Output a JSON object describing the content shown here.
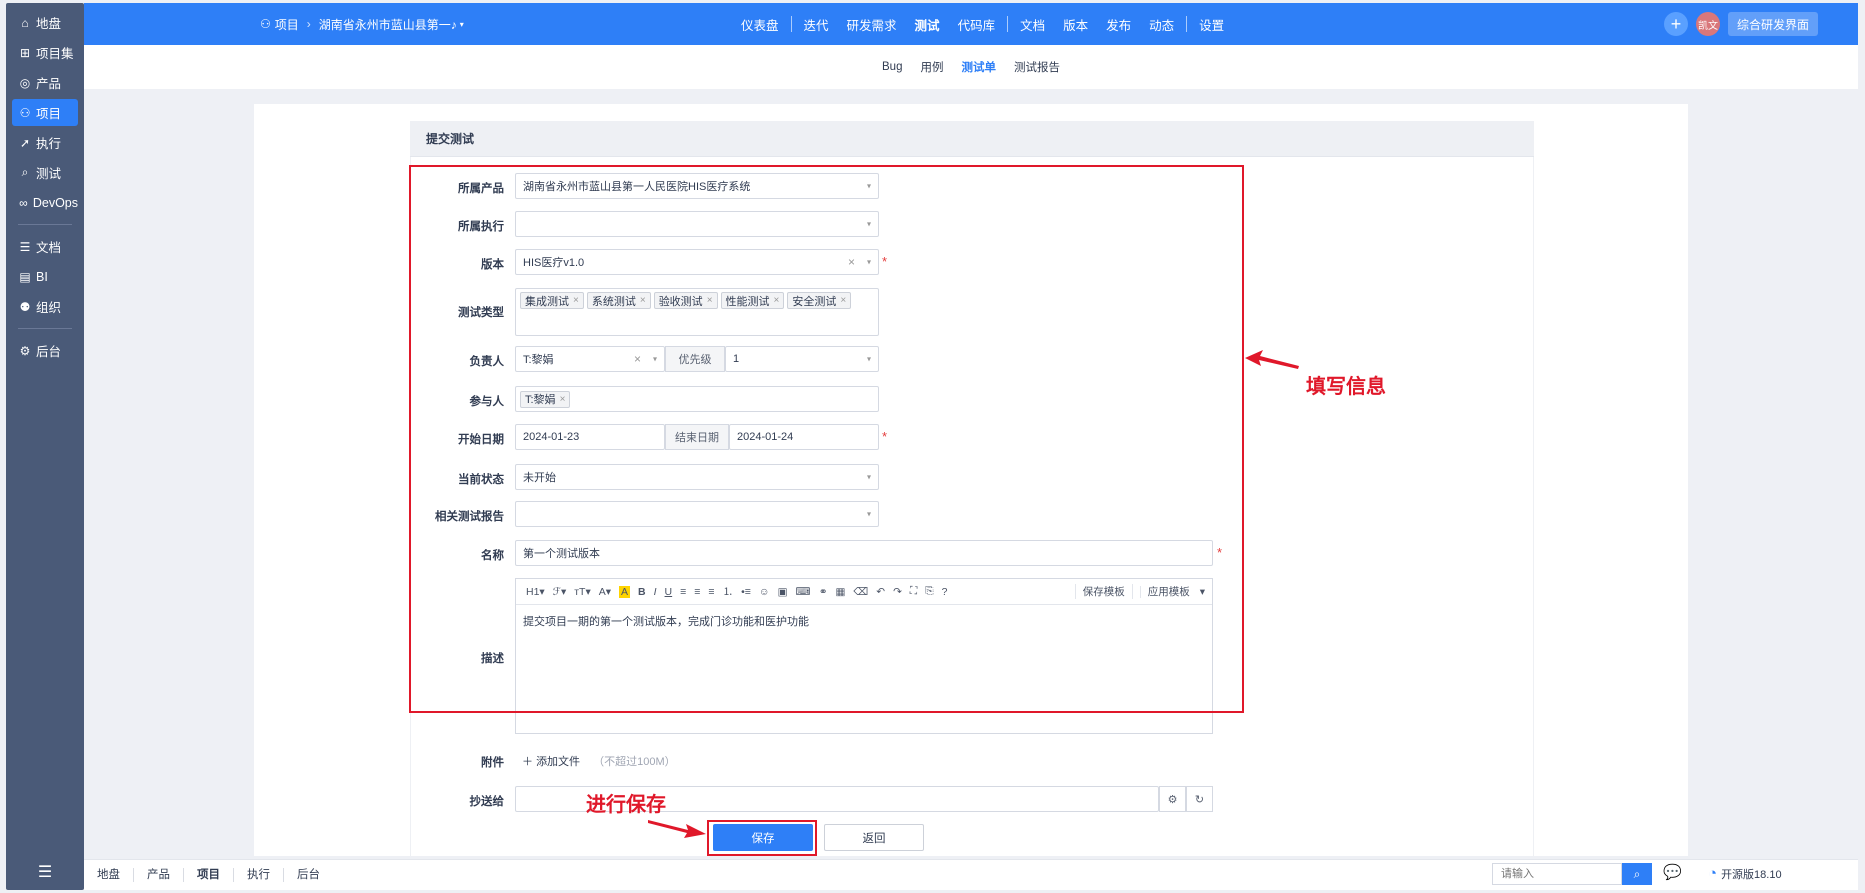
{
  "sidebar": {
    "items": [
      {
        "label": "地盘",
        "icon": "home-icon"
      },
      {
        "label": "项目集",
        "icon": "grid-icon"
      },
      {
        "label": "产品",
        "icon": "product-icon"
      },
      {
        "label": "项目",
        "icon": "project-icon"
      },
      {
        "label": "执行",
        "icon": "run-icon"
      },
      {
        "label": "测试",
        "icon": "test-icon"
      },
      {
        "label": "DevOps",
        "icon": "infinity-icon"
      },
      {
        "label": "文档",
        "icon": "doc-icon"
      },
      {
        "label": "BI",
        "icon": "chart-icon"
      },
      {
        "label": "组织",
        "icon": "people-icon"
      },
      {
        "label": "后台",
        "icon": "gear-icon"
      }
    ]
  },
  "header": {
    "crumb_root": "项目",
    "crumb_project": "湖南省永州市蓝山县第一♪",
    "nav": [
      "仪表盘",
      "迭代",
      "研发需求",
      "测试",
      "代码库",
      "文档",
      "版本",
      "发布",
      "动态",
      "设置"
    ],
    "avatar_text": "凯文",
    "switch_btn": "综合研发界面"
  },
  "subnav": [
    "Bug",
    "用例",
    "测试单",
    "测试报告"
  ],
  "form": {
    "title": "提交测试",
    "product_label": "所属产品",
    "product_value": "湖南省永州市蓝山县第一人民医院HIS医疗系统",
    "execution_label": "所属执行",
    "execution_value": "",
    "build_label": "版本",
    "build_value": "HIS医疗v1.0",
    "type_label": "测试类型",
    "types": [
      "集成测试",
      "系统测试",
      "验收测试",
      "性能测试",
      "安全测试"
    ],
    "owner_label": "负责人",
    "owner_value": "T:黎娟",
    "priority_label": "优先级",
    "priority_value": "1",
    "members_label": "参与人",
    "members": [
      "T:黎娟"
    ],
    "begin_label": "开始日期",
    "begin_value": "2024-01-23",
    "end_label": "结束日期",
    "end_value": "2024-01-24",
    "status_label": "当前状态",
    "status_value": "未开始",
    "report_label": "相关测试报告",
    "report_value": "",
    "name_label": "名称",
    "name_value": "第一个测试版本",
    "desc_label": "描述",
    "desc_value": "提交项目一期的第一个测试版本，完成门诊功能和医护功能",
    "toolbar_save_template": "保存模板",
    "toolbar_apply_template": "应用模板",
    "files_label": "附件",
    "add_file": "添加文件",
    "file_limit": "（不超过100M）",
    "mailto_label": "抄送给",
    "save_btn": "保存",
    "back_btn": "返回"
  },
  "annotations": {
    "fill_info": "填写信息",
    "save": "进行保存"
  },
  "bottom": {
    "tabs": [
      "地盘",
      "产品",
      "项目",
      "执行",
      "后台"
    ],
    "search_placeholder": "请输入",
    "version": "开源版18.10"
  },
  "colors": {
    "primary": "#2e7ff7",
    "sidebar": "#4a5a78",
    "annotation": "#e0182a"
  }
}
